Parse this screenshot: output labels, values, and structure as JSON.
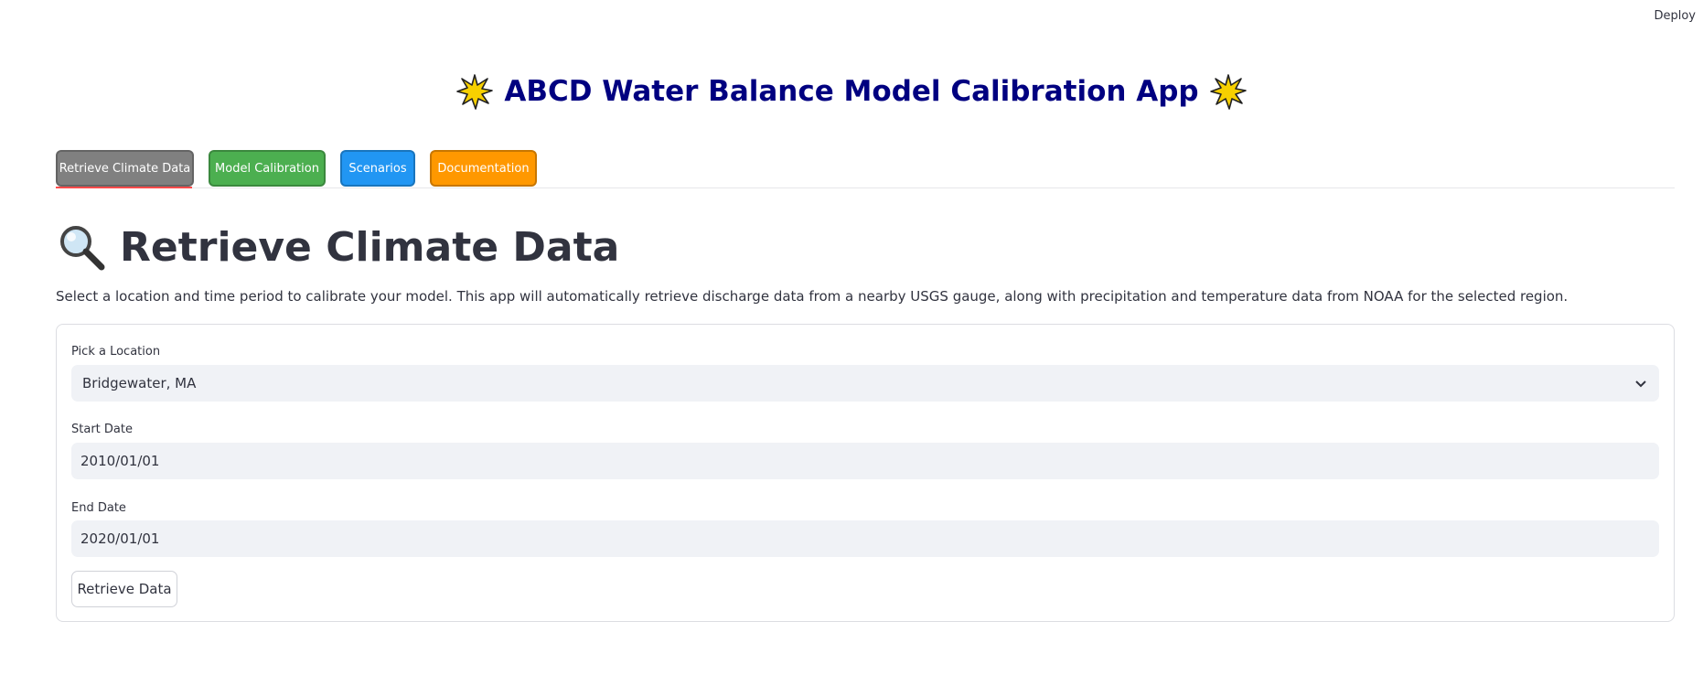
{
  "header": {
    "deploy_label": "Deploy"
  },
  "app": {
    "title": "ABCD Water Balance Model Calibration App",
    "title_color": "#000080"
  },
  "tabs": [
    {
      "label": "Retrieve Climate Data",
      "color": "#808080",
      "active": true
    },
    {
      "label": "Model Calibration",
      "color": "#4caf50",
      "active": false
    },
    {
      "label": "Scenarios",
      "color": "#2196f3",
      "active": false
    },
    {
      "label": "Documentation",
      "color": "#ff9800",
      "active": false
    }
  ],
  "section": {
    "icon": "magnifier-icon",
    "heading": "Retrieve Climate Data",
    "description": "Select a location and time period to calibrate your model. This app will automatically retrieve discharge data from a nearby USGS gauge, along with precipitation and temperature data from NOAA for the selected region."
  },
  "form": {
    "location_label": "Pick a Location",
    "location_value": "Bridgewater, MA",
    "start_label": "Start Date",
    "start_value": "2010/01/01",
    "end_label": "End Date",
    "end_value": "2020/01/01",
    "submit_label": "Retrieve Data"
  },
  "colors": {
    "active_tab_underline": "#ff4b4b",
    "input_background": "#f0f2f6"
  }
}
